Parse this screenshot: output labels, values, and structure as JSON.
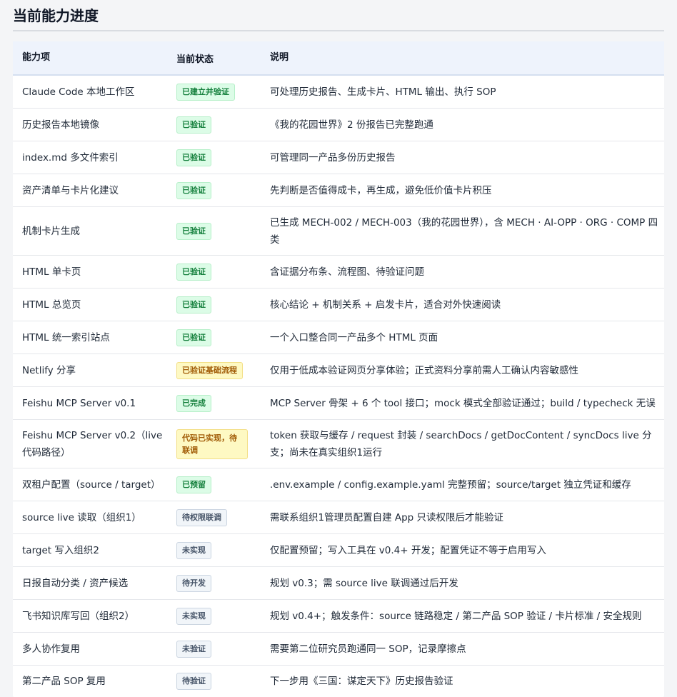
{
  "title": "当前能力进度",
  "headers": {
    "item": "能力项",
    "status": "当前状态",
    "desc": "说明"
  },
  "rows": [
    {
      "item": "Claude Code 本地工作区",
      "status": "已建立并验证",
      "tone": "green",
      "desc": "可处理历史报告、生成卡片、HTML 输出、执行 SOP"
    },
    {
      "item": "历史报告本地镜像",
      "status": "已验证",
      "tone": "green",
      "desc": "《我的花园世界》2 份报告已完整跑通"
    },
    {
      "item": "index.md 多文件索引",
      "status": "已验证",
      "tone": "green",
      "desc": "可管理同一产品多份历史报告"
    },
    {
      "item": "资产清单与卡片化建议",
      "status": "已验证",
      "tone": "green",
      "desc": "先判断是否值得成卡，再生成，避免低价值卡片积压"
    },
    {
      "item": "机制卡片生成",
      "status": "已验证",
      "tone": "green",
      "desc": "已生成 MECH-002 / MECH-003（我的花园世界），含 MECH · AI-OPP · ORG · COMP 四类"
    },
    {
      "item": "HTML 单卡页",
      "status": "已验证",
      "tone": "green",
      "desc": "含证据分布条、流程图、待验证问题"
    },
    {
      "item": "HTML 总览页",
      "status": "已验证",
      "tone": "green",
      "desc": "核心结论 + 机制关系 + 启发卡片，适合对外快速阅读"
    },
    {
      "item": "HTML 统一索引站点",
      "status": "已验证",
      "tone": "green",
      "desc": "一个入口整合同一产品多个 HTML 页面"
    },
    {
      "item": "Netlify 分享",
      "status": "已验证基础流程",
      "tone": "yellow",
      "desc": "仅用于低成本验证网页分享体验；正式资料分享前需人工确认内容敏感性"
    },
    {
      "item": "Feishu MCP Server v0.1",
      "status": "已完成",
      "tone": "green",
      "desc": "MCP Server 骨架 + 6 个 tool 接口；mock 模式全部验证通过；build / typecheck 无误"
    },
    {
      "item": "Feishu MCP Server v0.2（live 代码路径）",
      "status": "代码已实现，待联调",
      "tone": "yellow",
      "desc": "token 获取与缓存 / request 封装 / searchDocs / getDocContent / syncDocs live 分支；尚未在真实组织1运行"
    },
    {
      "item": "双租户配置（source / target）",
      "status": "已预留",
      "tone": "green",
      "desc": ".env.example / config.example.yaml 完整预留；source/target 独立凭证和缓存"
    },
    {
      "item": "source live 读取（组织1）",
      "status": "待权限联调",
      "tone": "gray",
      "desc": "需联系组织1管理员配置自建 App 只读权限后才能验证"
    },
    {
      "item": "target 写入组织2",
      "status": "未实现",
      "tone": "gray",
      "desc": "仅配置预留；写入工具在 v0.4+ 开发；配置凭证不等于启用写入"
    },
    {
      "item": "日报自动分类 / 资产候选",
      "status": "待开发",
      "tone": "gray",
      "desc": "规划 v0.3；需 source live 联调通过后开发"
    },
    {
      "item": "飞书知识库写回（组织2）",
      "status": "未实现",
      "tone": "gray",
      "desc": "规划 v0.4+；触发条件：source 链路稳定 / 第二产品 SOP 验证 / 卡片标准 / 安全规则"
    },
    {
      "item": "多人协作复用",
      "status": "未验证",
      "tone": "gray",
      "desc": "需要第二位研究员跑通同一 SOP，记录摩擦点"
    },
    {
      "item": "第二产品 SOP 复用",
      "status": "待验证",
      "tone": "gray",
      "desc": "下一步用《三国：谋定天下》历史报告验证"
    }
  ]
}
